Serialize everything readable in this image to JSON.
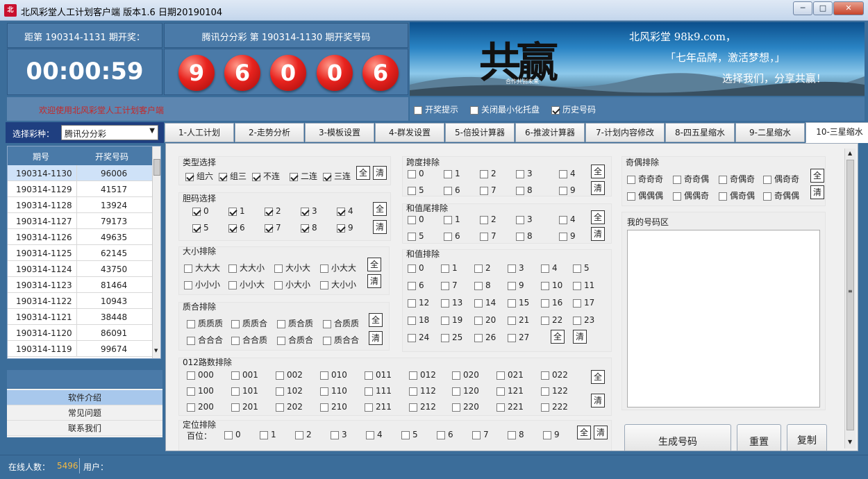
{
  "window": {
    "title": "北风彩堂人工计划客户端    版本1.6  日期20190104",
    "icon": "app-logo-icon",
    "controls": {
      "minimize": "─",
      "maximize": "□",
      "close": "✕"
    }
  },
  "countdown": {
    "label": "距第 190314-1131 期开奖：",
    "time": "00:00:59"
  },
  "result": {
    "label": "腾讯分分彩 第 190314-1130 期开奖号码",
    "balls": [
      "9",
      "6",
      "0",
      "0",
      "6"
    ]
  },
  "banner": {
    "calligraphy": "共赢",
    "motto": "合作共创未来",
    "site": "北风彩堂 98k9.com，",
    "slogan1": "「七年品牌，激活梦想，」",
    "slogan2": "选择我们，分享共赢！"
  },
  "welcome": "欢迎使用北风彩堂人工计划客户端",
  "options": [
    {
      "label": "开奖提示",
      "checked": false
    },
    {
      "label": "关闭最小化托盘",
      "checked": false
    },
    {
      "label": "历史号码",
      "checked": true
    }
  ],
  "lottery": {
    "label": "选择彩种：",
    "selected": "腾讯分分彩"
  },
  "history": {
    "headers": [
      "期号",
      "开奖号码"
    ],
    "rows": [
      [
        "190314-1130",
        "96006"
      ],
      [
        "190314-1129",
        "41517"
      ],
      [
        "190314-1128",
        "13924"
      ],
      [
        "190314-1127",
        "79173"
      ],
      [
        "190314-1126",
        "49635"
      ],
      [
        "190314-1125",
        "62145"
      ],
      [
        "190314-1124",
        "43750"
      ],
      [
        "190314-1123",
        "81464"
      ],
      [
        "190314-1122",
        "10943"
      ],
      [
        "190314-1121",
        "38448"
      ],
      [
        "190314-1120",
        "86091"
      ],
      [
        "190314-1119",
        "99674"
      ]
    ]
  },
  "nav": [
    "软件介绍",
    "常见问题",
    "联系我们"
  ],
  "tabs": [
    "1-人工计划",
    "2-走势分析",
    "3-模板设置",
    "4-群发设置",
    "5-倍投计算器",
    "6-推波计算器",
    "7-计划内容修改",
    "8-四五星缩水",
    "9-二星缩水",
    "10-三星缩水"
  ],
  "active_tab": "10-三星缩水",
  "btn_all": "全",
  "btn_clear": "清",
  "type_sel": {
    "title": "类型选择",
    "items": [
      "组六",
      "组三",
      "不连",
      "二连",
      "三连"
    ]
  },
  "dan_sel": {
    "title": "胆码选择",
    "items": [
      "0",
      "1",
      "2",
      "3",
      "4",
      "5",
      "6",
      "7",
      "8",
      "9"
    ]
  },
  "size_ex": {
    "title": "大小排除",
    "items": [
      "大大大",
      "大大小",
      "大小大",
      "小大大",
      "小小小",
      "小小大",
      "小大小",
      "大小小"
    ]
  },
  "zh_ex": {
    "title": "质合排除",
    "items": [
      "质质质",
      "质质合",
      "质合质",
      "合质质",
      "合合合",
      "合合质",
      "合质合",
      "质合合"
    ]
  },
  "r012_ex": {
    "title": "012路数排除",
    "items": [
      "000",
      "001",
      "002",
      "010",
      "011",
      "012",
      "020",
      "021",
      "022",
      "100",
      "101",
      "102",
      "110",
      "111",
      "112",
      "120",
      "121",
      "122",
      "200",
      "201",
      "202",
      "210",
      "211",
      "212",
      "220",
      "221",
      "222"
    ]
  },
  "pos_ex": {
    "title": "定位排除",
    "row_label": "百位：",
    "items": [
      "0",
      "1",
      "2",
      "3",
      "4",
      "5",
      "6",
      "7",
      "8",
      "9"
    ]
  },
  "span_ex": {
    "title": "跨度排除",
    "items": [
      "0",
      "1",
      "2",
      "3",
      "4",
      "5",
      "6",
      "7",
      "8",
      "9"
    ]
  },
  "sumtail_ex": {
    "title": "和值尾排除",
    "items": [
      "0",
      "1",
      "2",
      "3",
      "4",
      "5",
      "6",
      "7",
      "8",
      "9"
    ]
  },
  "sum_ex": {
    "title": "和值排除",
    "items": [
      "0",
      "1",
      "2",
      "3",
      "4",
      "5",
      "6",
      "7",
      "8",
      "9",
      "10",
      "11",
      "12",
      "13",
      "14",
      "15",
      "16",
      "17",
      "18",
      "19",
      "20",
      "21",
      "22",
      "23",
      "24",
      "25",
      "26",
      "27"
    ]
  },
  "oe_ex": {
    "title": "奇偶排除",
    "items": [
      "奇奇奇",
      "奇奇偶",
      "奇偶奇",
      "偶奇奇",
      "偶偶偶",
      "偶偶奇",
      "偶奇偶",
      "奇偶偶"
    ]
  },
  "my_numbers": {
    "title": "我的号码区"
  },
  "actions": [
    "生成号码",
    "重置",
    "复制"
  ],
  "status": {
    "online_label": "在线人数：",
    "online_count": "5496",
    "user_label": "用户："
  }
}
